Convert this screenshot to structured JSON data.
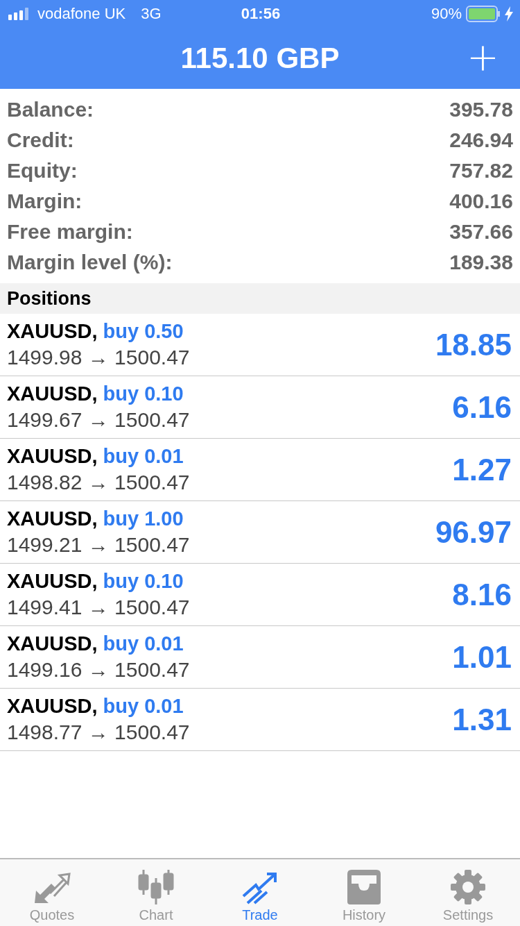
{
  "status_bar": {
    "carrier": "vodafone UK",
    "network": "3G",
    "time": "01:56",
    "battery": "90%",
    "charging": true
  },
  "header": {
    "title": "115.10 GBP",
    "action": "+"
  },
  "account": [
    {
      "label": "Balance:",
      "value": "395.78"
    },
    {
      "label": "Credit:",
      "value": "246.94"
    },
    {
      "label": "Equity:",
      "value": "757.82"
    },
    {
      "label": "Margin:",
      "value": "400.16"
    },
    {
      "label": "Free margin:",
      "value": "357.66"
    },
    {
      "label": "Margin level (%):",
      "value": "189.38"
    }
  ],
  "positions": {
    "title": "Positions",
    "rows": [
      {
        "symbol": "XAUUSD,",
        "order": "buy 0.50",
        "prices": "1499.98 → 1500.47",
        "profit": "18.85"
      },
      {
        "symbol": "XAUUSD,",
        "order": "buy 0.10",
        "prices": "1499.67 → 1500.47",
        "profit": "6.16"
      },
      {
        "symbol": "XAUUSD,",
        "order": "buy 0.01",
        "prices": "1498.82 → 1500.47",
        "profit": "1.27"
      },
      {
        "symbol": "XAUUSD,",
        "order": "buy 1.00",
        "prices": "1499.21 → 1500.47",
        "profit": "96.97"
      },
      {
        "symbol": "XAUUSD,",
        "order": "buy 0.10",
        "prices": "1499.41 → 1500.47",
        "profit": "8.16"
      },
      {
        "symbol": "XAUUSD,",
        "order": "buy 0.01",
        "prices": "1499.16 → 1500.47",
        "profit": "1.01"
      },
      {
        "symbol": "XAUUSD,",
        "order": "buy 0.01",
        "prices": "1498.77 → 1500.47",
        "profit": "1.31"
      }
    ]
  },
  "tab_bar": [
    {
      "label": "Quotes",
      "kind": "quotes",
      "selected": false
    },
    {
      "label": "Chart",
      "kind": "chart",
      "selected": false
    },
    {
      "label": "Trade",
      "kind": "trade",
      "selected": true
    },
    {
      "label": "History",
      "kind": "history",
      "selected": false
    },
    {
      "label": "Settings",
      "kind": "settings",
      "selected": false
    }
  ]
}
